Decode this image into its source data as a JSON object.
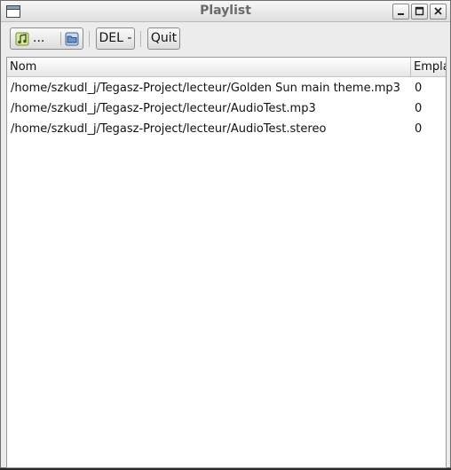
{
  "window": {
    "title": "Playlist",
    "minimize_icon": "minimize-icon",
    "maximize_icon": "maximize-icon",
    "close_icon": "close-icon"
  },
  "toolbar": {
    "add_files_label": "...",
    "add_files_icon": "music-note-icon",
    "open_folder_icon": "folder-icon",
    "delete_label": "DEL -",
    "quit_label": "Quit"
  },
  "table": {
    "columns": [
      "Nom",
      "Empla"
    ],
    "rows": [
      {
        "name": "/home/szkudl_j/Tegasz-Project/lecteur/Golden Sun main theme.mp3",
        "slot": "0"
      },
      {
        "name": "/home/szkudl_j/Tegasz-Project/lecteur/AudioTest.mp3",
        "slot": "0"
      },
      {
        "name": "/home/szkudl_j/Tegasz-Project/lecteur/AudioTest.stereo",
        "slot": "0"
      }
    ]
  }
}
